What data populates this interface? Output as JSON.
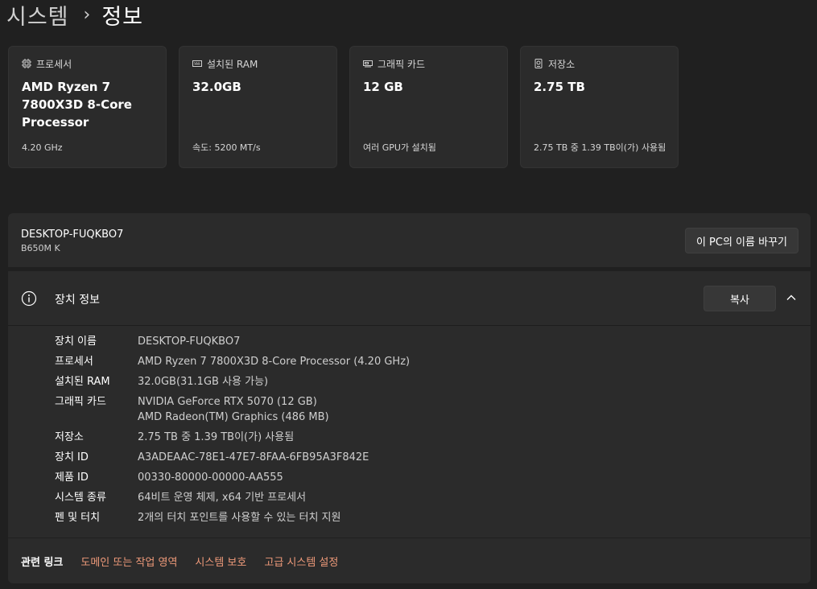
{
  "breadcrumb": {
    "parent": "시스템",
    "separator": "›",
    "current": "정보"
  },
  "cards": [
    {
      "icon": "cpu-icon",
      "title": "프로세서",
      "value": "AMD Ryzen 7 7800X3D 8-Core Processor",
      "sub": "4.20 GHz"
    },
    {
      "icon": "ram-icon",
      "title": "설치된 RAM",
      "value": "32.0GB",
      "sub": "속도: 5200 MT/s"
    },
    {
      "icon": "gpu-icon",
      "title": "그래픽 카드",
      "value": "12 GB",
      "sub": "여러 GPU가 설치됨"
    },
    {
      "icon": "storage-icon",
      "title": "저장소",
      "value": "2.75 TB",
      "sub": "2.75 TB 중 1.39 TB이(가) 사용됨"
    }
  ],
  "device": {
    "name": "DESKTOP-FUQKBO7",
    "model": "B650M K",
    "rename_label": "이 PC의 이름 바꾸기"
  },
  "spec": {
    "title": "장치 정보",
    "copy_label": "복사",
    "rows": [
      {
        "key": "장치 이름",
        "value": "DESKTOP-FUQKBO7"
      },
      {
        "key": "프로세서",
        "value": "AMD Ryzen 7 7800X3D 8-Core Processor (4.20 GHz)"
      },
      {
        "key": "설치된 RAM",
        "value": "32.0GB(31.1GB 사용 가능)"
      },
      {
        "key": "그래픽 카드",
        "value": "NVIDIA GeForce RTX 5070 (12 GB)",
        "value2": "AMD Radeon(TM) Graphics (486 MB)"
      },
      {
        "key": "저장소",
        "value": "2.75 TB 중 1.39 TB이(가) 사용됨"
      },
      {
        "key": "장치 ID",
        "value": "A3ADEAAC-78E1-47E7-8FAA-6FB95A3F842E"
      },
      {
        "key": "제품 ID",
        "value": "00330-80000-00000-AA555"
      },
      {
        "key": "시스템 종류",
        "value": "64비트 운영 체제, x64 기반 프로세서"
      },
      {
        "key": "펜 및 터치",
        "value": "2개의 터치 포인트를 사용할 수 있는 터치 지원"
      }
    ]
  },
  "related": {
    "label": "관련 링크",
    "links": [
      "도메인 또는 작업 영역",
      "시스템 보호",
      "고급 시스템 설정"
    ]
  },
  "colors": {
    "background": "#202020",
    "card": "#2b2b2b",
    "link": "#ef9a7a"
  }
}
